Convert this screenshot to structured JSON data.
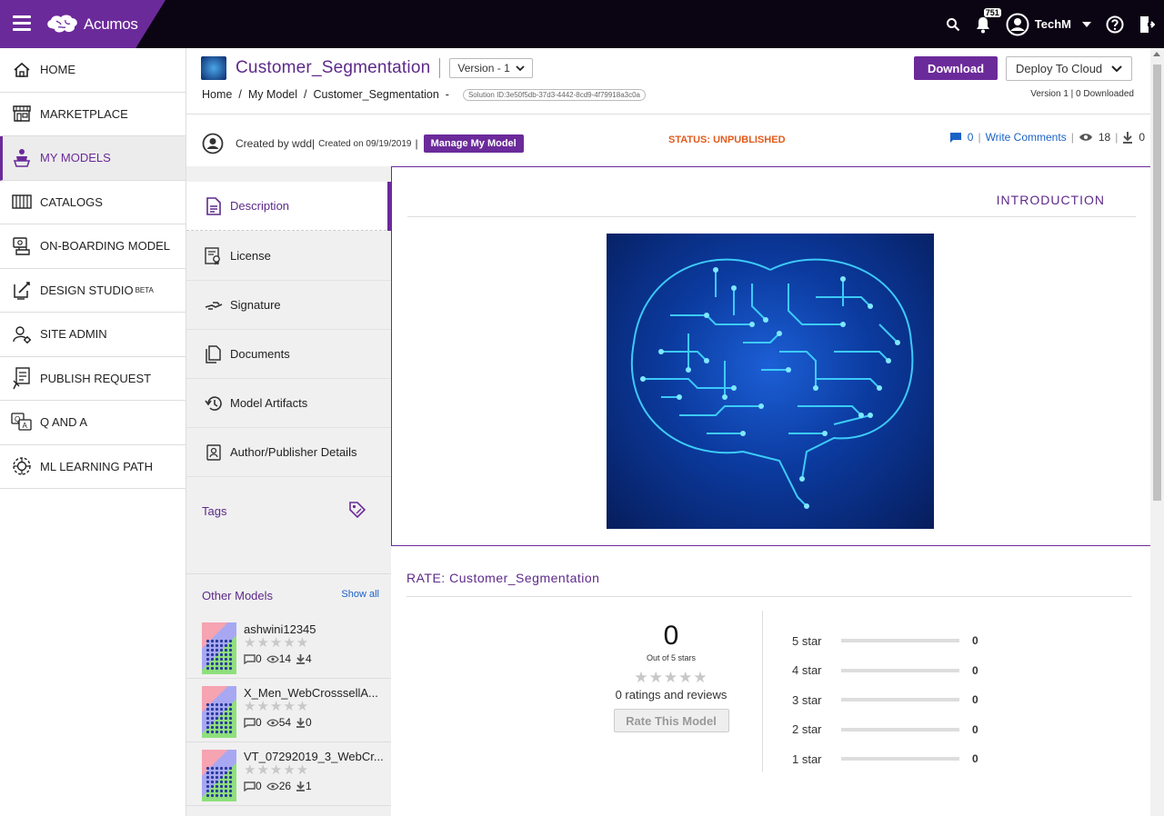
{
  "topbar": {
    "brand": "Acumos",
    "notification_count": "751",
    "user": "TechM"
  },
  "sidebar": {
    "items": [
      {
        "label": "HOME",
        "icon": "home-icon"
      },
      {
        "label": "MARKETPLACE",
        "icon": "store-icon"
      },
      {
        "label": "MY MODELS",
        "icon": "models-icon",
        "active": true
      },
      {
        "label": "CATALOGS",
        "icon": "catalog-icon"
      },
      {
        "label": "ON-BOARDING MODEL",
        "icon": "onboarding-icon"
      },
      {
        "label": "DESIGN STUDIO",
        "sup": "BETA",
        "icon": "design-studio-icon"
      },
      {
        "label": "SITE ADMIN",
        "icon": "admin-icon"
      },
      {
        "label": "PUBLISH REQUEST",
        "icon": "publish-icon"
      },
      {
        "label": "Q AND A",
        "icon": "qa-icon"
      },
      {
        "label": "ML LEARNING PATH",
        "icon": "learning-icon"
      }
    ]
  },
  "header": {
    "title": "Customer_Segmentation",
    "version": "Version - 1",
    "breadcrumb": [
      "Home",
      "My Model",
      "Customer_Segmentation"
    ],
    "solution_id": "Solution ID:3e50f5db-37d3-4442-8cd9-4f79918a3c0a",
    "download": "Download",
    "deploy": "Deploy To Cloud",
    "version_info": "Version 1 | 0 Downloaded",
    "created_by": "Created by wdd",
    "created_on": "Created on 09/19/2019",
    "manage": "Manage My Model",
    "status": "STATUS: UNPUBLISHED",
    "comments": "0",
    "write_comments": "Write Comments",
    "views": "18",
    "downloads": "0"
  },
  "tabs": [
    {
      "label": "Description",
      "icon": "description-icon",
      "active": true
    },
    {
      "label": "License",
      "icon": "license-icon"
    },
    {
      "label": "Signature",
      "icon": "signature-icon"
    },
    {
      "label": "Documents",
      "icon": "documents-icon"
    },
    {
      "label": "Model Artifacts",
      "icon": "artifacts-icon"
    },
    {
      "label": "Author/Publisher Details",
      "icon": "author-icon"
    }
  ],
  "tags_label": "Tags",
  "other_models": {
    "title": "Other Models",
    "show_all": "Show all",
    "items": [
      {
        "name": "ashwini12345",
        "comments": "0",
        "views": "14",
        "downloads": "4"
      },
      {
        "name": "X_Men_WebCrosssellA...",
        "comments": "0",
        "views": "54",
        "downloads": "0"
      },
      {
        "name": "VT_07292019_3_WebCr...",
        "comments": "0",
        "views": "26",
        "downloads": "1"
      }
    ]
  },
  "intro_heading": "INTRODUCTION",
  "rating": {
    "title": "RATE: Customer_Segmentation",
    "score": "0",
    "out_of": "Out of 5 stars",
    "reviews": "0 ratings and reviews",
    "rate_button": "Rate This Model",
    "bars": [
      {
        "label": "5 star",
        "value": 0
      },
      {
        "label": "4 star",
        "value": 0
      },
      {
        "label": "3 star",
        "value": 0
      },
      {
        "label": "2 star",
        "value": 0
      },
      {
        "label": "1 star",
        "value": 0
      }
    ]
  }
}
